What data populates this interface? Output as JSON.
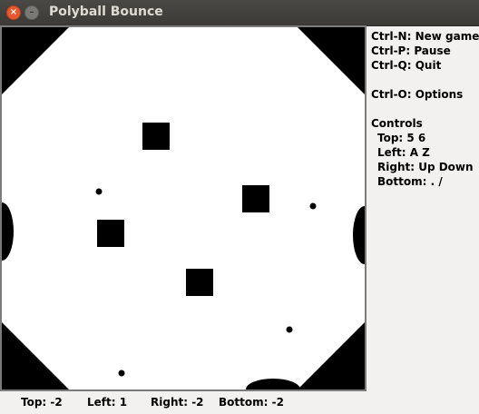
{
  "window": {
    "title": "Polyball Bounce"
  },
  "menu": {
    "new_game": "Ctrl-N: New game",
    "pause": "Ctrl-P: Pause",
    "quit": "Ctrl-Q: Quit",
    "options": "Ctrl-O: Options"
  },
  "controls": {
    "heading": "Controls",
    "top": "Top: 5 6",
    "left": "Left: A Z",
    "right": "Right: Up Down",
    "bottom": "Bottom: . /"
  },
  "scores": {
    "top": "Top: -2",
    "left": "Left: 1",
    "right": "Right: -2",
    "bottom": "Bottom: -2"
  },
  "colors": {
    "board": "#ffffff",
    "walls": "#000000",
    "titlebar": "#3c3b37",
    "close_button": "#e8592d"
  }
}
